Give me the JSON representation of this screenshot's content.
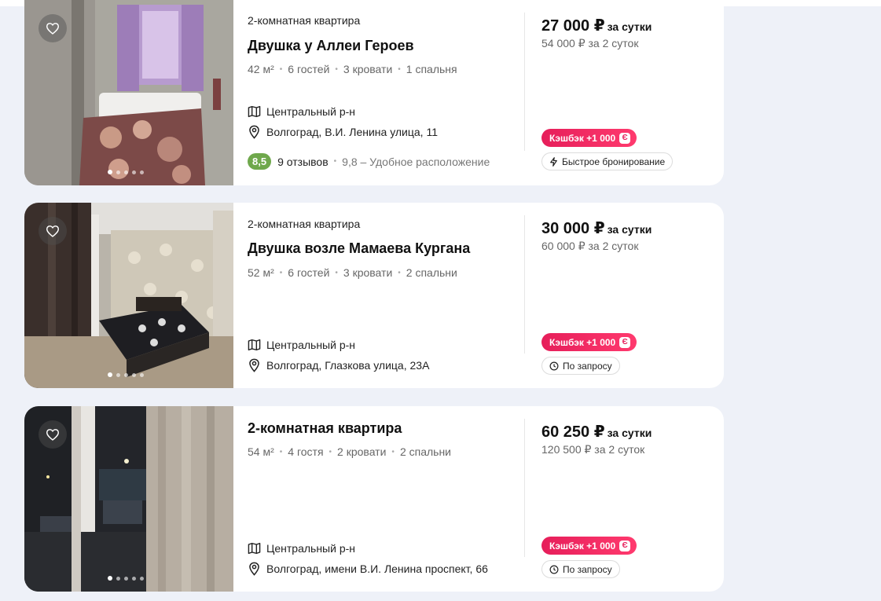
{
  "listings": [
    {
      "subtype": "2-комнатная квартира",
      "title": "Двушка у Аллеи Героев",
      "specs": [
        "42 м²",
        "6 гостей",
        "3 кровати",
        "1 спальня"
      ],
      "district": "Центральный р-н",
      "address": "Волгоград, В.И. Ленина улица, 11",
      "rating": {
        "score": "8,5",
        "reviews": "9 отзывов",
        "note": "9,8 – Удобное расположение"
      },
      "price": "27 000 ₽",
      "price_unit": "за сутки",
      "price_total": "54 000 ₽ за 2 суток",
      "cashback": "Кэшбэк +1 000",
      "booking_tag": "Быстрое бронирование",
      "photo_count": 5,
      "active_photo": 1
    },
    {
      "subtype": "2-комнатная квартира",
      "title": "Двушка возле Мамаева Кургана",
      "specs": [
        "52 м²",
        "6 гостей",
        "3 кровати",
        "2 спальни"
      ],
      "district": "Центральный р-н",
      "address": "Волгоград, Глазкова улица, 23А",
      "price": "30 000 ₽",
      "price_unit": "за сутки",
      "price_total": "60 000 ₽ за 2 суток",
      "cashback": "Кэшбэк +1 000",
      "booking_tag": "По запросу",
      "photo_count": 5,
      "active_photo": 1
    },
    {
      "subtype": "",
      "title": "2-комнатная квартира",
      "specs": [
        "54 м²",
        "4 гостя",
        "2 кровати",
        "2 спальни"
      ],
      "district": "Центральный р-н",
      "address": "Волгоград, имени В.И. Ленина проспект, 66",
      "price": "60 250 ₽",
      "price_unit": "за сутки",
      "price_total": "120 500 ₽ за 2 суток",
      "cashback": "Кэшбэк +1 000",
      "booking_tag": "По запросу",
      "photo_count": 5,
      "active_photo": 1
    }
  ],
  "cashback_icon_letter": "Є",
  "colors": {
    "page_bg": "#eef1f8",
    "rating_badge": "#6fa84c",
    "cashback": "#e61e5a"
  }
}
